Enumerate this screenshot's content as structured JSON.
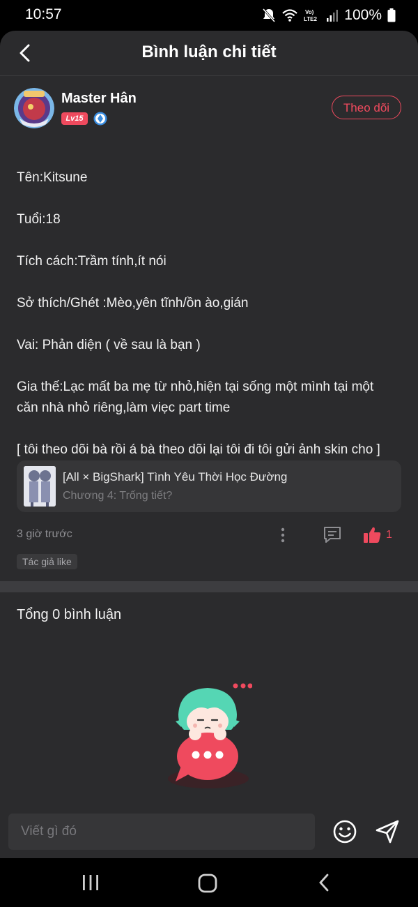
{
  "status_bar": {
    "time": "10:57",
    "battery": "100%",
    "icons": [
      "mute-icon",
      "wifi-icon",
      "volte-lte2-icon",
      "signal-icon",
      "battery-icon"
    ]
  },
  "header": {
    "title": "Bình luận chi tiết",
    "back_icon": "chevron-left-icon"
  },
  "author": {
    "name": "Master Hân",
    "level": "Lv15",
    "follow_label": "Theo dõi",
    "verified_icon": "diamond-badge-icon"
  },
  "comment": {
    "lines": [
      "Tên:Kitsune",
      "Tuổi:18",
      "Tích cách:Trầm tính,ít nói",
      "Sở thích/Ghét :Mèo,yên tĩnh/ồn ào,gián",
      "Vai: Phản diện ( về sau là bạn )",
      "Gia thế:Lạc mất ba mẹ từ nhỏ,hiện tại sống một mình tại một căn nhà nhỏ riêng,làm viẹc part time",
      "[ tôi theo dõi bà rồi á bà theo dõi lại tôi đi tôi gửi ảnh skin cho ]"
    ]
  },
  "story": {
    "title": "[All × BigShark] Tình Yêu Thời Học Đường",
    "chapter": "Chương 4: Trống tiết?"
  },
  "meta": {
    "time": "3 giờ trước",
    "like_count": "1",
    "author_like_tag": "Tác giả like"
  },
  "comments_section": {
    "total": "Tổng 0 bình luận"
  },
  "composer": {
    "placeholder": "Viết gì đó"
  },
  "colors": {
    "accent": "#ef4a5e",
    "background": "#2b2b2d",
    "surface": "#363638"
  }
}
